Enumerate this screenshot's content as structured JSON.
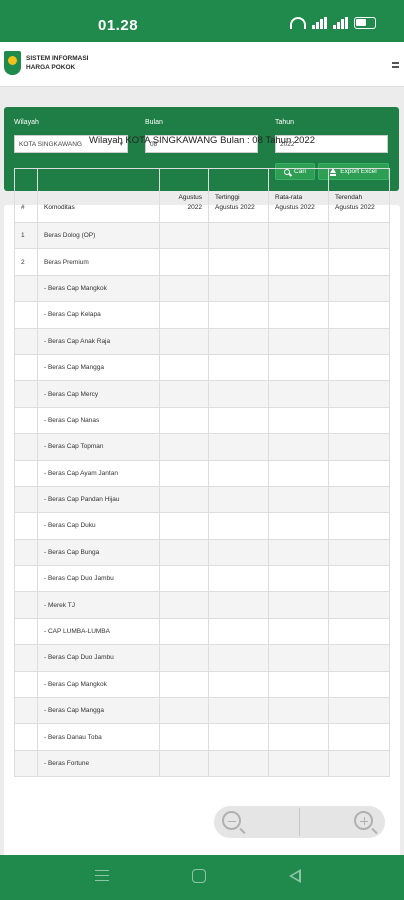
{
  "status_bar": {
    "time": "01.28"
  },
  "app": {
    "title_line1": "SISTEM INFORMASI",
    "title_line2": "HARGA POKOK"
  },
  "filter": {
    "wilayah_label": "Wilayah",
    "wilayah_value": "KOTA SINGKAWANG",
    "bulan_label": "Bulan",
    "bulan_value": "08",
    "tahun_label": "Tahun",
    "tahun_value": "2022",
    "cari_label": "Cari",
    "export_label": "Export Excel"
  },
  "report": {
    "title": "Wilayah KOTA SINGKAWANG Bulan : 08 Tahun 2022",
    "headers": {
      "no": "#",
      "komoditas": "Komoditas",
      "agustus": "Agustus 2022",
      "tertinggi": "Tertinggi Agustus 2022",
      "rata": "Rata-rata Agustus 2022",
      "terendah": "Terendah Agustus 2022"
    },
    "rows": [
      {
        "no": "1",
        "name": "Beras Dolog (OP)"
      },
      {
        "no": "2",
        "name": "Beras Premium"
      },
      {
        "no": "",
        "name": "- Beras Cap Mangkok"
      },
      {
        "no": "",
        "name": "- Beras Cap Kelapa"
      },
      {
        "no": "",
        "name": "- Beras Cap Anak Raja"
      },
      {
        "no": "",
        "name": "- Beras Cap Mangga"
      },
      {
        "no": "",
        "name": "- Beras Cap Mercy"
      },
      {
        "no": "",
        "name": "- Beras Cap Nanas"
      },
      {
        "no": "",
        "name": "- Beras Cap Topman"
      },
      {
        "no": "",
        "name": "- Beras Cap Ayam Jantan"
      },
      {
        "no": "",
        "name": "- Beras Cap Pandan Hijau"
      },
      {
        "no": "",
        "name": "- Beras Cap Duku"
      },
      {
        "no": "",
        "name": "- Beras Cap Bunga"
      },
      {
        "no": "",
        "name": "- Beras Cap Duo Jambu"
      },
      {
        "no": "",
        "name": "- Merek TJ"
      },
      {
        "no": "",
        "name": "- CAP LUMBA-LUMBA"
      },
      {
        "no": "",
        "name": "- Beras Cap Duo Jambu"
      },
      {
        "no": "",
        "name": "- Beras Cap Mangkok"
      },
      {
        "no": "",
        "name": "- Beras Cap Mangga"
      },
      {
        "no": "",
        "name": "- Beras Danau Toba"
      },
      {
        "no": "",
        "name": "- Beras Fortune"
      }
    ]
  },
  "colors": {
    "primary": "#1f8a4c",
    "panel": "#1f7d46",
    "button": "#2e9e55"
  },
  "icons": [
    "wifi-icon",
    "signal-icon",
    "battery-icon",
    "logo",
    "menu-icon",
    "search-icon",
    "upload-icon",
    "zoom-out-icon",
    "zoom-in-icon",
    "recents-icon",
    "home-icon",
    "back-icon"
  ]
}
